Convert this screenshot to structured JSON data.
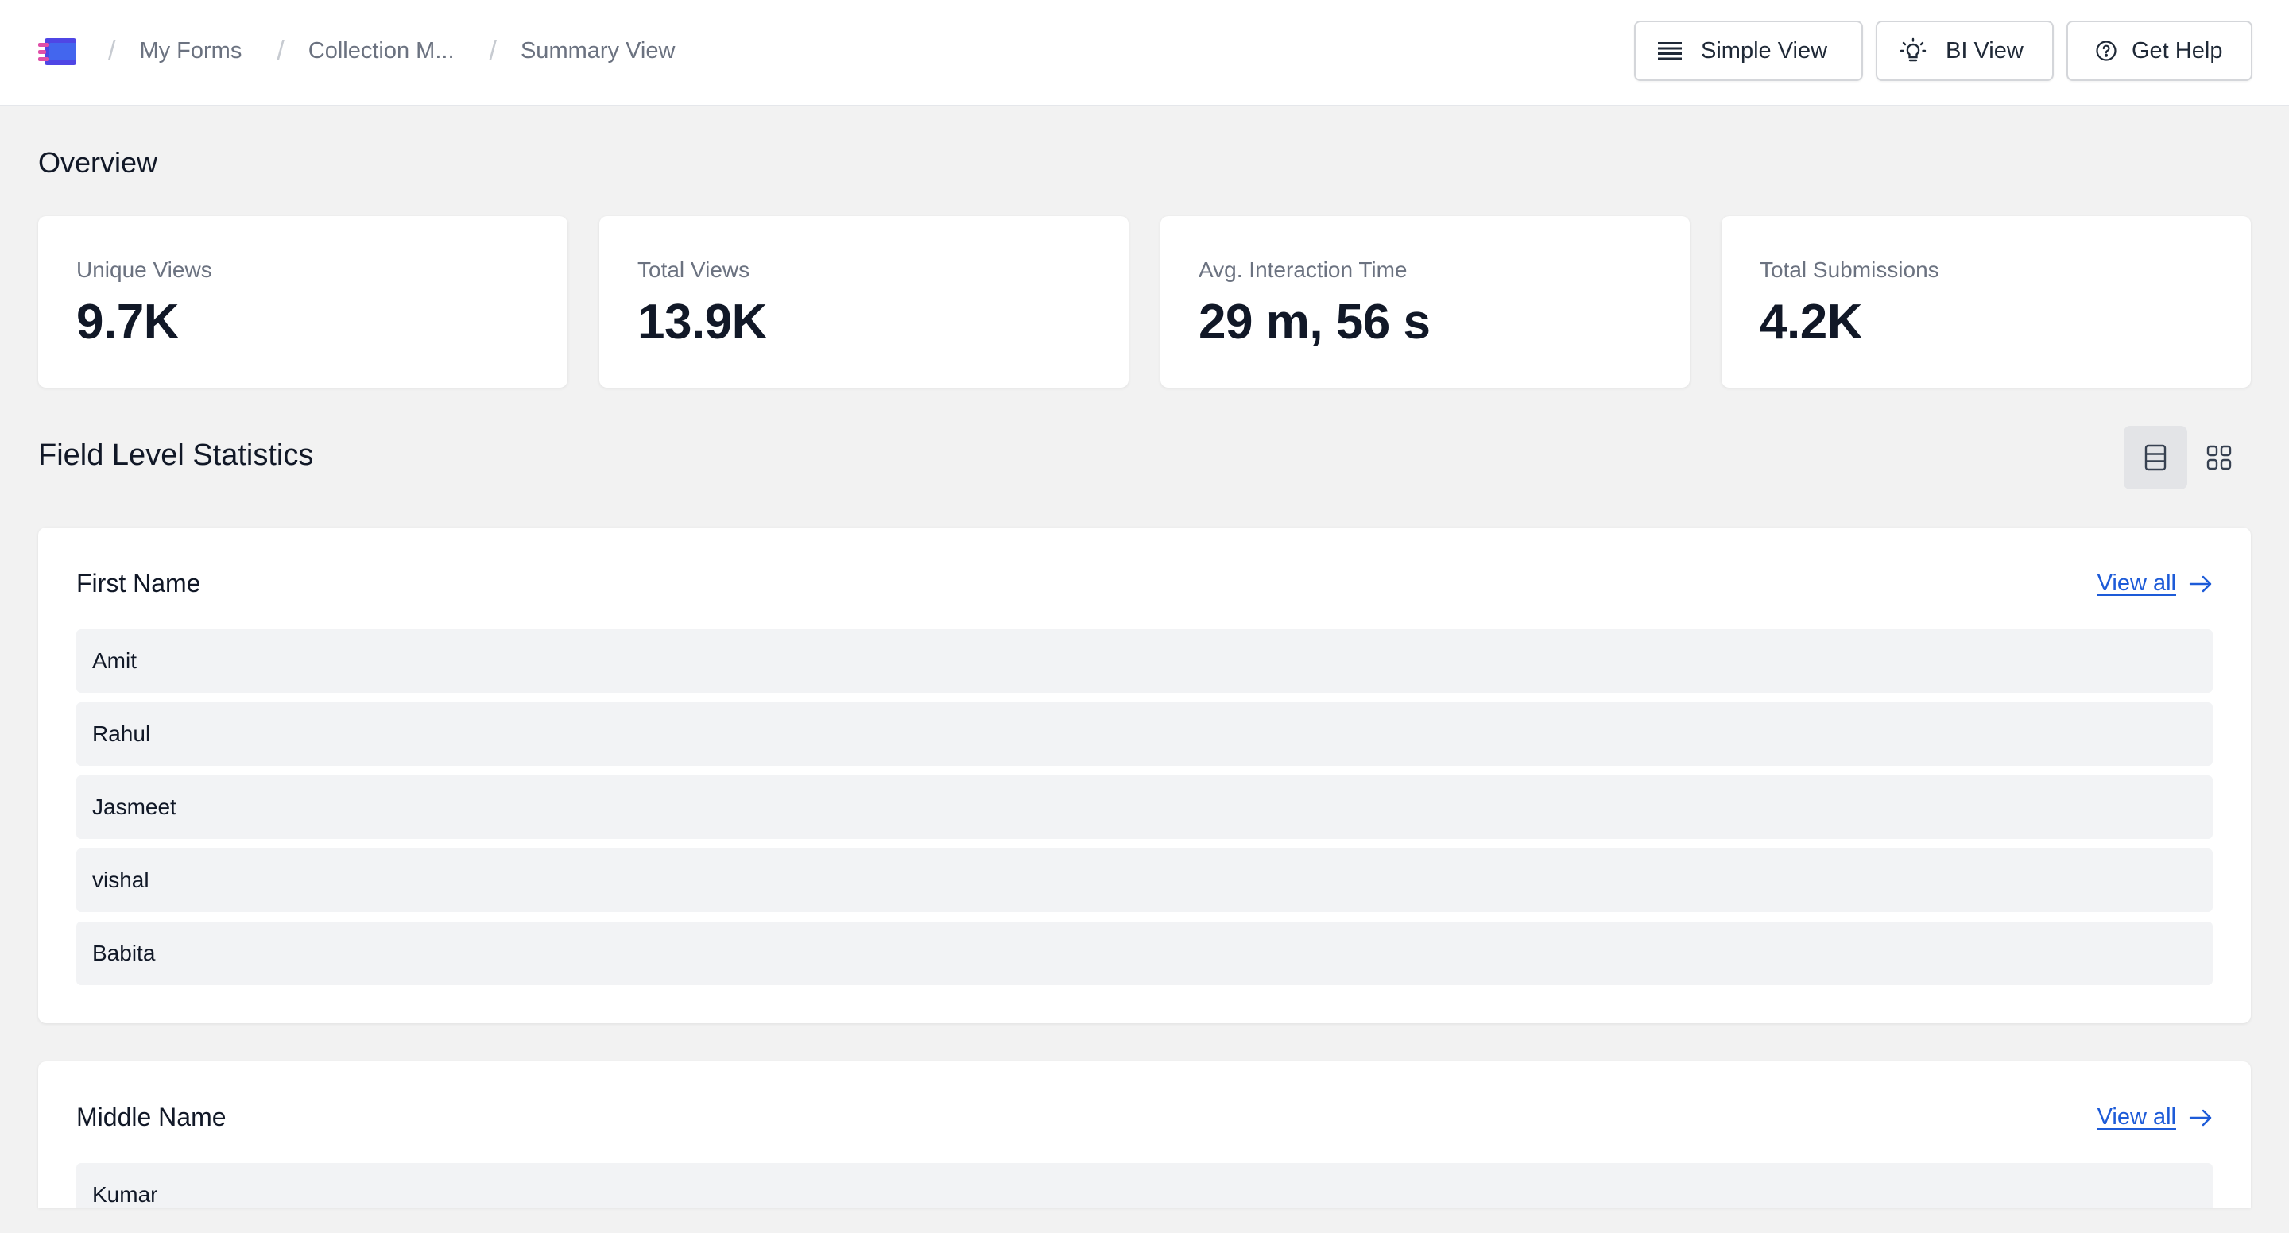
{
  "header": {
    "breadcrumbs": [
      "My Forms",
      "Collection M...",
      "Summary View"
    ],
    "buttons": {
      "simple_view": "Simple View",
      "bi_view": "BI View",
      "get_help": "Get Help"
    }
  },
  "overview": {
    "title": "Overview",
    "stats": [
      {
        "label": "Unique Views",
        "value": "9.7K"
      },
      {
        "label": "Total Views",
        "value": "13.9K"
      },
      {
        "label": "Avg. Interaction Time",
        "value": "29 m, 56 s"
      },
      {
        "label": "Total Submissions",
        "value": "4.2K"
      }
    ]
  },
  "field_stats": {
    "title": "Field Level Statistics",
    "view_all_label": "View all",
    "fields": [
      {
        "name": "First Name",
        "values": [
          "Amit",
          "Rahul",
          "Jasmeet",
          "vishal",
          "Babita"
        ]
      },
      {
        "name": "Middle Name",
        "values": [
          "Kumar"
        ]
      }
    ]
  },
  "colors": {
    "accent_link": "#1d5bd8",
    "logo_primary": "#4f46e5",
    "logo_secondary": "#e04fa8"
  },
  "icons": {
    "logo": "app-logo-icon",
    "simple_view": "list-lines-icon",
    "bi_view": "lightbulb-icon",
    "get_help": "help-circle-icon",
    "view_all": "arrow-right-icon",
    "list_layout": "list-layout-icon",
    "grid_layout": "grid-layout-icon"
  }
}
